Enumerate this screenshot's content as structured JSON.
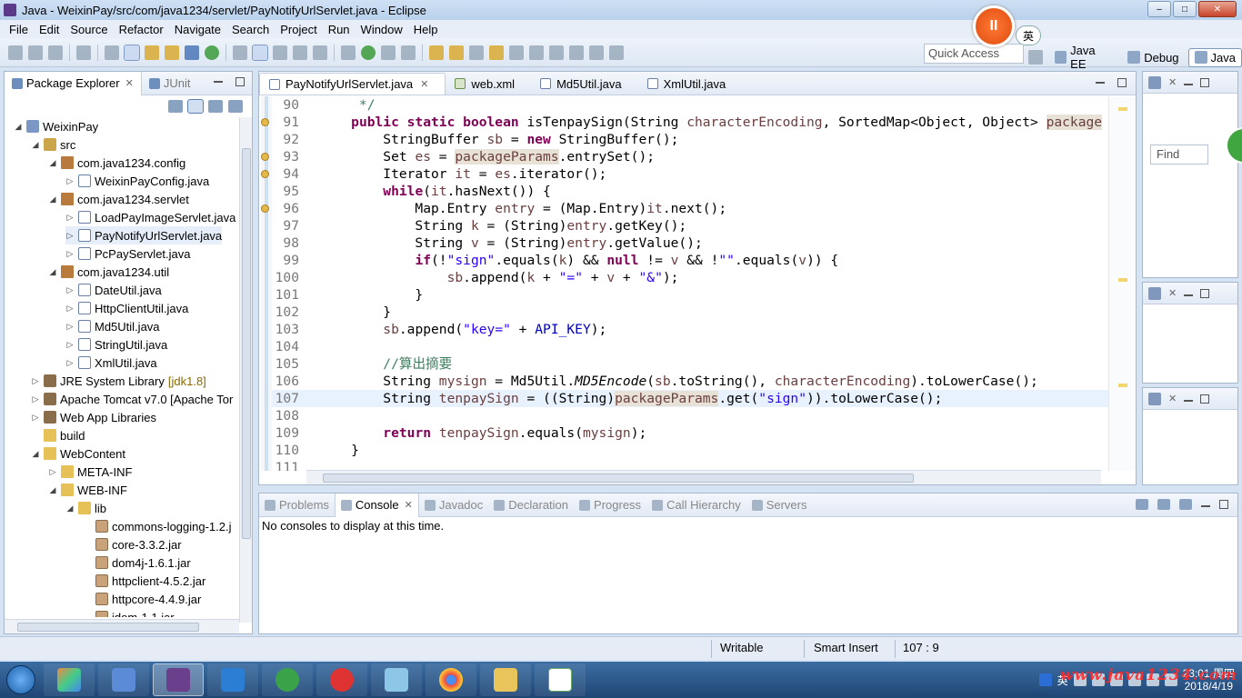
{
  "window": {
    "title": "Java - WeixinPay/src/com/java1234/servlet/PayNotifyUrlServlet.java - Eclipse",
    "buttons": [
      "–",
      "□",
      "✕"
    ]
  },
  "recorder": {
    "pause_label": "II",
    "ime_label": "英"
  },
  "menu": [
    "File",
    "Edit",
    "Source",
    "Refactor",
    "Navigate",
    "Search",
    "Project",
    "Run",
    "Window",
    "Help"
  ],
  "toolbar": {
    "quick_access": "Quick Access"
  },
  "perspectives": [
    {
      "label": "Java EE",
      "icon": "java-ee-perspective-icon"
    },
    {
      "label": "Debug",
      "icon": "debug-perspective-icon"
    },
    {
      "label": "Java",
      "icon": "java-perspective-icon",
      "active": true
    }
  ],
  "package_explorer": {
    "tabs": [
      {
        "label": "Package Explorer",
        "close": "✕"
      },
      {
        "label": "JUnit"
      }
    ],
    "tree": [
      {
        "label": "WeixinPay",
        "depth": 0,
        "expanded": "open",
        "icon": "project"
      },
      {
        "label": "src",
        "depth": 1,
        "expanded": "open",
        "icon": "src"
      },
      {
        "label": "com.java1234.config",
        "depth": 2,
        "expanded": "open",
        "icon": "pkg"
      },
      {
        "label": "WeixinPayConfig.java",
        "depth": 3,
        "expanded": "closed",
        "icon": "java"
      },
      {
        "label": "com.java1234.servlet",
        "depth": 2,
        "expanded": "open",
        "icon": "pkg"
      },
      {
        "label": "LoadPayImageServlet.java",
        "depth": 3,
        "expanded": "closed",
        "icon": "java"
      },
      {
        "label": "PayNotifyUrlServlet.java",
        "depth": 3,
        "expanded": "closed",
        "icon": "java",
        "selected": true
      },
      {
        "label": "PcPayServlet.java",
        "depth": 3,
        "expanded": "closed",
        "icon": "java"
      },
      {
        "label": "com.java1234.util",
        "depth": 2,
        "expanded": "open",
        "icon": "pkg"
      },
      {
        "label": "DateUtil.java",
        "depth": 3,
        "expanded": "closed",
        "icon": "java"
      },
      {
        "label": "HttpClientUtil.java",
        "depth": 3,
        "expanded": "closed",
        "icon": "java"
      },
      {
        "label": "Md5Util.java",
        "depth": 3,
        "expanded": "closed",
        "icon": "java"
      },
      {
        "label": "StringUtil.java",
        "depth": 3,
        "expanded": "closed",
        "icon": "java"
      },
      {
        "label": "XmlUtil.java",
        "depth": 3,
        "expanded": "closed",
        "icon": "java"
      },
      {
        "label": "JRE System Library",
        "suffix": "[jdk1.8]",
        "depth": 1,
        "expanded": "closed",
        "icon": "lib"
      },
      {
        "label": "Apache Tomcat v7.0 [Apache Tor",
        "depth": 1,
        "expanded": "closed",
        "icon": "lib"
      },
      {
        "label": "Web App Libraries",
        "depth": 1,
        "expanded": "closed",
        "icon": "lib"
      },
      {
        "label": "build",
        "depth": 1,
        "expanded": "none",
        "icon": "folder"
      },
      {
        "label": "WebContent",
        "depth": 1,
        "expanded": "open",
        "icon": "folder"
      },
      {
        "label": "META-INF",
        "depth": 2,
        "expanded": "closed",
        "icon": "folder"
      },
      {
        "label": "WEB-INF",
        "depth": 2,
        "expanded": "open",
        "icon": "folder"
      },
      {
        "label": "lib",
        "depth": 3,
        "expanded": "open",
        "icon": "folder"
      },
      {
        "label": "commons-logging-1.2.j",
        "depth": 4,
        "expanded": "none",
        "icon": "jar"
      },
      {
        "label": "core-3.3.2.jar",
        "depth": 4,
        "expanded": "none",
        "icon": "jar"
      },
      {
        "label": "dom4j-1.6.1.jar",
        "depth": 4,
        "expanded": "none",
        "icon": "jar"
      },
      {
        "label": "httpclient-4.5.2.jar",
        "depth": 4,
        "expanded": "none",
        "icon": "jar"
      },
      {
        "label": "httpcore-4.4.9.jar",
        "depth": 4,
        "expanded": "none",
        "icon": "jar"
      },
      {
        "label": "jdom-1.1.jar",
        "depth": 4,
        "expanded": "none",
        "icon": "jar"
      }
    ]
  },
  "editor": {
    "tabs": [
      {
        "label": "PayNotifyUrlServlet.java",
        "active": true,
        "close": "✕",
        "icon": "java"
      },
      {
        "label": "web.xml",
        "icon": "xml"
      },
      {
        "label": "Md5Util.java",
        "icon": "java"
      },
      {
        "label": "XmlUtil.java",
        "icon": "java"
      }
    ],
    "current_line": 107,
    "lines": [
      {
        "n": "90",
        "tokens": [
          [
            "c",
            "     */"
          ]
        ]
      },
      {
        "n": "91",
        "tokens": [
          [
            "p",
            "    "
          ],
          [
            "k",
            "public static boolean"
          ],
          [
            "p",
            " isTenpaySign(String "
          ],
          [
            "v",
            "characterEncoding"
          ],
          [
            "p",
            ", SortedMap<Object, Object> "
          ],
          [
            "h",
            "package"
          ]
        ]
      },
      {
        "n": "92",
        "tokens": [
          [
            "p",
            "        StringBuffer "
          ],
          [
            "v",
            "sb"
          ],
          [
            "p",
            " = "
          ],
          [
            "k",
            "new"
          ],
          [
            "p",
            " StringBuffer();"
          ]
        ]
      },
      {
        "n": "93",
        "tokens": [
          [
            "p",
            "        Set "
          ],
          [
            "v",
            "es"
          ],
          [
            "p",
            " = "
          ],
          [
            "h",
            "packageParams"
          ],
          [
            "p",
            ".entrySet();"
          ]
        ]
      },
      {
        "n": "94",
        "tokens": [
          [
            "p",
            "        Iterator "
          ],
          [
            "v",
            "it"
          ],
          [
            "p",
            " = "
          ],
          [
            "v",
            "es"
          ],
          [
            "p",
            ".iterator();"
          ]
        ]
      },
      {
        "n": "95",
        "tokens": [
          [
            "p",
            "        "
          ],
          [
            "k",
            "while"
          ],
          [
            "p",
            "("
          ],
          [
            "v",
            "it"
          ],
          [
            "p",
            ".hasNext()) {"
          ]
        ]
      },
      {
        "n": "96",
        "tokens": [
          [
            "p",
            "            Map.Entry "
          ],
          [
            "v",
            "entry"
          ],
          [
            "p",
            " = (Map.Entry)"
          ],
          [
            "v",
            "it"
          ],
          [
            "p",
            ".next();"
          ]
        ]
      },
      {
        "n": "97",
        "tokens": [
          [
            "p",
            "            String "
          ],
          [
            "v",
            "k"
          ],
          [
            "p",
            " = (String)"
          ],
          [
            "v",
            "entry"
          ],
          [
            "p",
            ".getKey();"
          ]
        ]
      },
      {
        "n": "98",
        "tokens": [
          [
            "p",
            "            String "
          ],
          [
            "v",
            "v"
          ],
          [
            "p",
            " = (String)"
          ],
          [
            "v",
            "entry"
          ],
          [
            "p",
            ".getValue();"
          ]
        ]
      },
      {
        "n": "99",
        "tokens": [
          [
            "p",
            "            "
          ],
          [
            "k",
            "if"
          ],
          [
            "p",
            "(!"
          ],
          [
            "s",
            "\"sign\""
          ],
          [
            "p",
            ".equals("
          ],
          [
            "v",
            "k"
          ],
          [
            "p",
            ") && "
          ],
          [
            "k",
            "null"
          ],
          [
            "p",
            " != "
          ],
          [
            "v",
            "v"
          ],
          [
            "p",
            " && !"
          ],
          [
            "s",
            "\"\""
          ],
          [
            "p",
            ".equals("
          ],
          [
            "v",
            "v"
          ],
          [
            "p",
            ")) {"
          ]
        ]
      },
      {
        "n": "100",
        "tokens": [
          [
            "p",
            "                "
          ],
          [
            "v",
            "sb"
          ],
          [
            "p",
            ".append("
          ],
          [
            "v",
            "k"
          ],
          [
            "p",
            " + "
          ],
          [
            "s",
            "\"=\""
          ],
          [
            "p",
            " + "
          ],
          [
            "v",
            "v"
          ],
          [
            "p",
            " + "
          ],
          [
            "s",
            "\"&\""
          ],
          [
            "p",
            ");"
          ]
        ]
      },
      {
        "n": "101",
        "tokens": [
          [
            "p",
            "            }"
          ]
        ]
      },
      {
        "n": "102",
        "tokens": [
          [
            "p",
            "        }"
          ]
        ]
      },
      {
        "n": "103",
        "tokens": [
          [
            "p",
            "        "
          ],
          [
            "v",
            "sb"
          ],
          [
            "p",
            ".append("
          ],
          [
            "s",
            "\"key=\""
          ],
          [
            "p",
            " + "
          ],
          [
            "f",
            "API_KEY"
          ],
          [
            "p",
            ");"
          ]
        ]
      },
      {
        "n": "104",
        "tokens": []
      },
      {
        "n": "105",
        "tokens": [
          [
            "p",
            "        "
          ],
          [
            "c",
            "//算出摘要"
          ]
        ]
      },
      {
        "n": "106",
        "tokens": [
          [
            "p",
            "        String "
          ],
          [
            "v",
            "mysign"
          ],
          [
            "p",
            " = Md5Util."
          ],
          [
            "i",
            "MD5Encode"
          ],
          [
            "p",
            "("
          ],
          [
            "v",
            "sb"
          ],
          [
            "p",
            ".toString(), "
          ],
          [
            "v",
            "characterEncoding"
          ],
          [
            "p",
            ").toLowerCase();"
          ]
        ]
      },
      {
        "n": "107",
        "tokens": [
          [
            "p",
            "        String "
          ],
          [
            "v",
            "tenpaySign"
          ],
          [
            "p",
            " = ((String)"
          ],
          [
            "h",
            "packageParams"
          ],
          [
            "p",
            ".get("
          ],
          [
            "s",
            "\"sign\""
          ],
          [
            "p",
            ")).toLowerCase();"
          ]
        ]
      },
      {
        "n": "108",
        "tokens": []
      },
      {
        "n": "109",
        "tokens": [
          [
            "p",
            "        "
          ],
          [
            "k",
            "return"
          ],
          [
            "p",
            " "
          ],
          [
            "v",
            "tenpaySign"
          ],
          [
            "p",
            ".equals("
          ],
          [
            "v",
            "mysign"
          ],
          [
            "p",
            ");"
          ]
        ]
      },
      {
        "n": "110",
        "tokens": [
          [
            "p",
            "    }"
          ]
        ]
      },
      {
        "n": "111",
        "tokens": []
      }
    ],
    "warning_lines": [
      "91",
      "93",
      "94",
      "96"
    ]
  },
  "console": {
    "tabs": [
      {
        "label": "Problems"
      },
      {
        "label": "Console",
        "active": true,
        "close": "✕"
      },
      {
        "label": "Javadoc"
      },
      {
        "label": "Declaration"
      },
      {
        "label": "Progress"
      },
      {
        "label": "Call Hierarchy"
      },
      {
        "label": "Servers"
      }
    ],
    "message": "No consoles to display at this time."
  },
  "right_panels": {
    "find_label": "Find",
    "close": "✕"
  },
  "statusbar": {
    "writable": "Writable",
    "insert_mode": "Smart Insert",
    "position": "107 : 9"
  },
  "taskbar": {
    "apps": [
      "windows-start",
      "chrome-colorful",
      "dolphin",
      "eclipse",
      "wps-writer",
      "browser",
      "snail",
      "notes",
      "chrome",
      "explorer",
      "notepad"
    ],
    "tray_ime": "英",
    "clock_time": "23:01 周四",
    "clock_date": "2018/4/19",
    "watermark": "www.java1234.com"
  }
}
